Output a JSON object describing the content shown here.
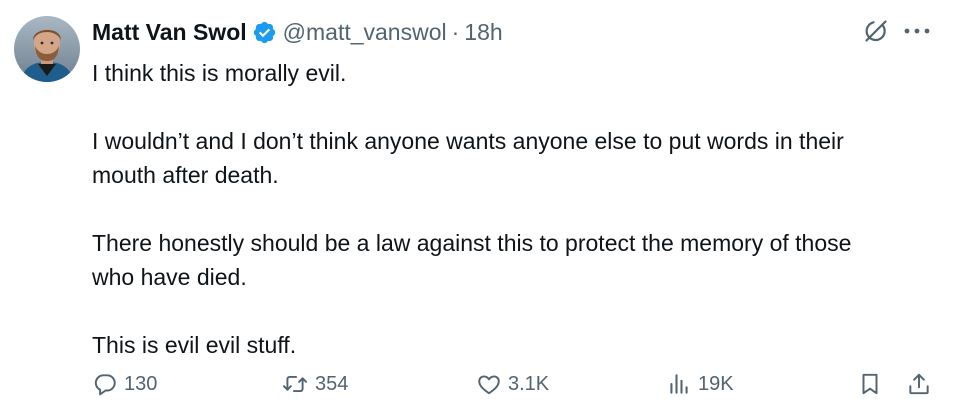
{
  "author": {
    "display_name": "Matt Van Swol",
    "handle": "@matt_vanswol",
    "separator": "·",
    "time": "18h",
    "verified_color": "#1d9bf0",
    "avatar_icon": "avatar-photo"
  },
  "tweet": {
    "paragraphs": [
      "I think this is morally evil.",
      "I wouldn’t and I don’t think anyone wants anyone else to put words in their mouth after death.",
      "There honestly should be a law against this to protect the memory of those who have died.",
      "This is evil evil stuff."
    ],
    "line_breaks": {
      "p2_line1": "I wouldn’t and I don’t think anyone wants anyone else to put words in their",
      "p2_line2": "mouth after death.",
      "p3_line1": "There honestly should be a law against this to protect the memory of those",
      "p3_line2": "who have died."
    }
  },
  "header_icons": {
    "grok": "grok-icon",
    "more": "more-icon"
  },
  "actions": {
    "replies": "130",
    "reposts": "354",
    "likes": "3.1K",
    "views": "19K",
    "icons": [
      "reply-icon",
      "repost-icon",
      "like-icon",
      "views-icon",
      "bookmark-icon",
      "share-icon"
    ]
  },
  "colors": {
    "text": "#0f1419",
    "secondary": "#536471",
    "brand": "#1d9bf0"
  }
}
